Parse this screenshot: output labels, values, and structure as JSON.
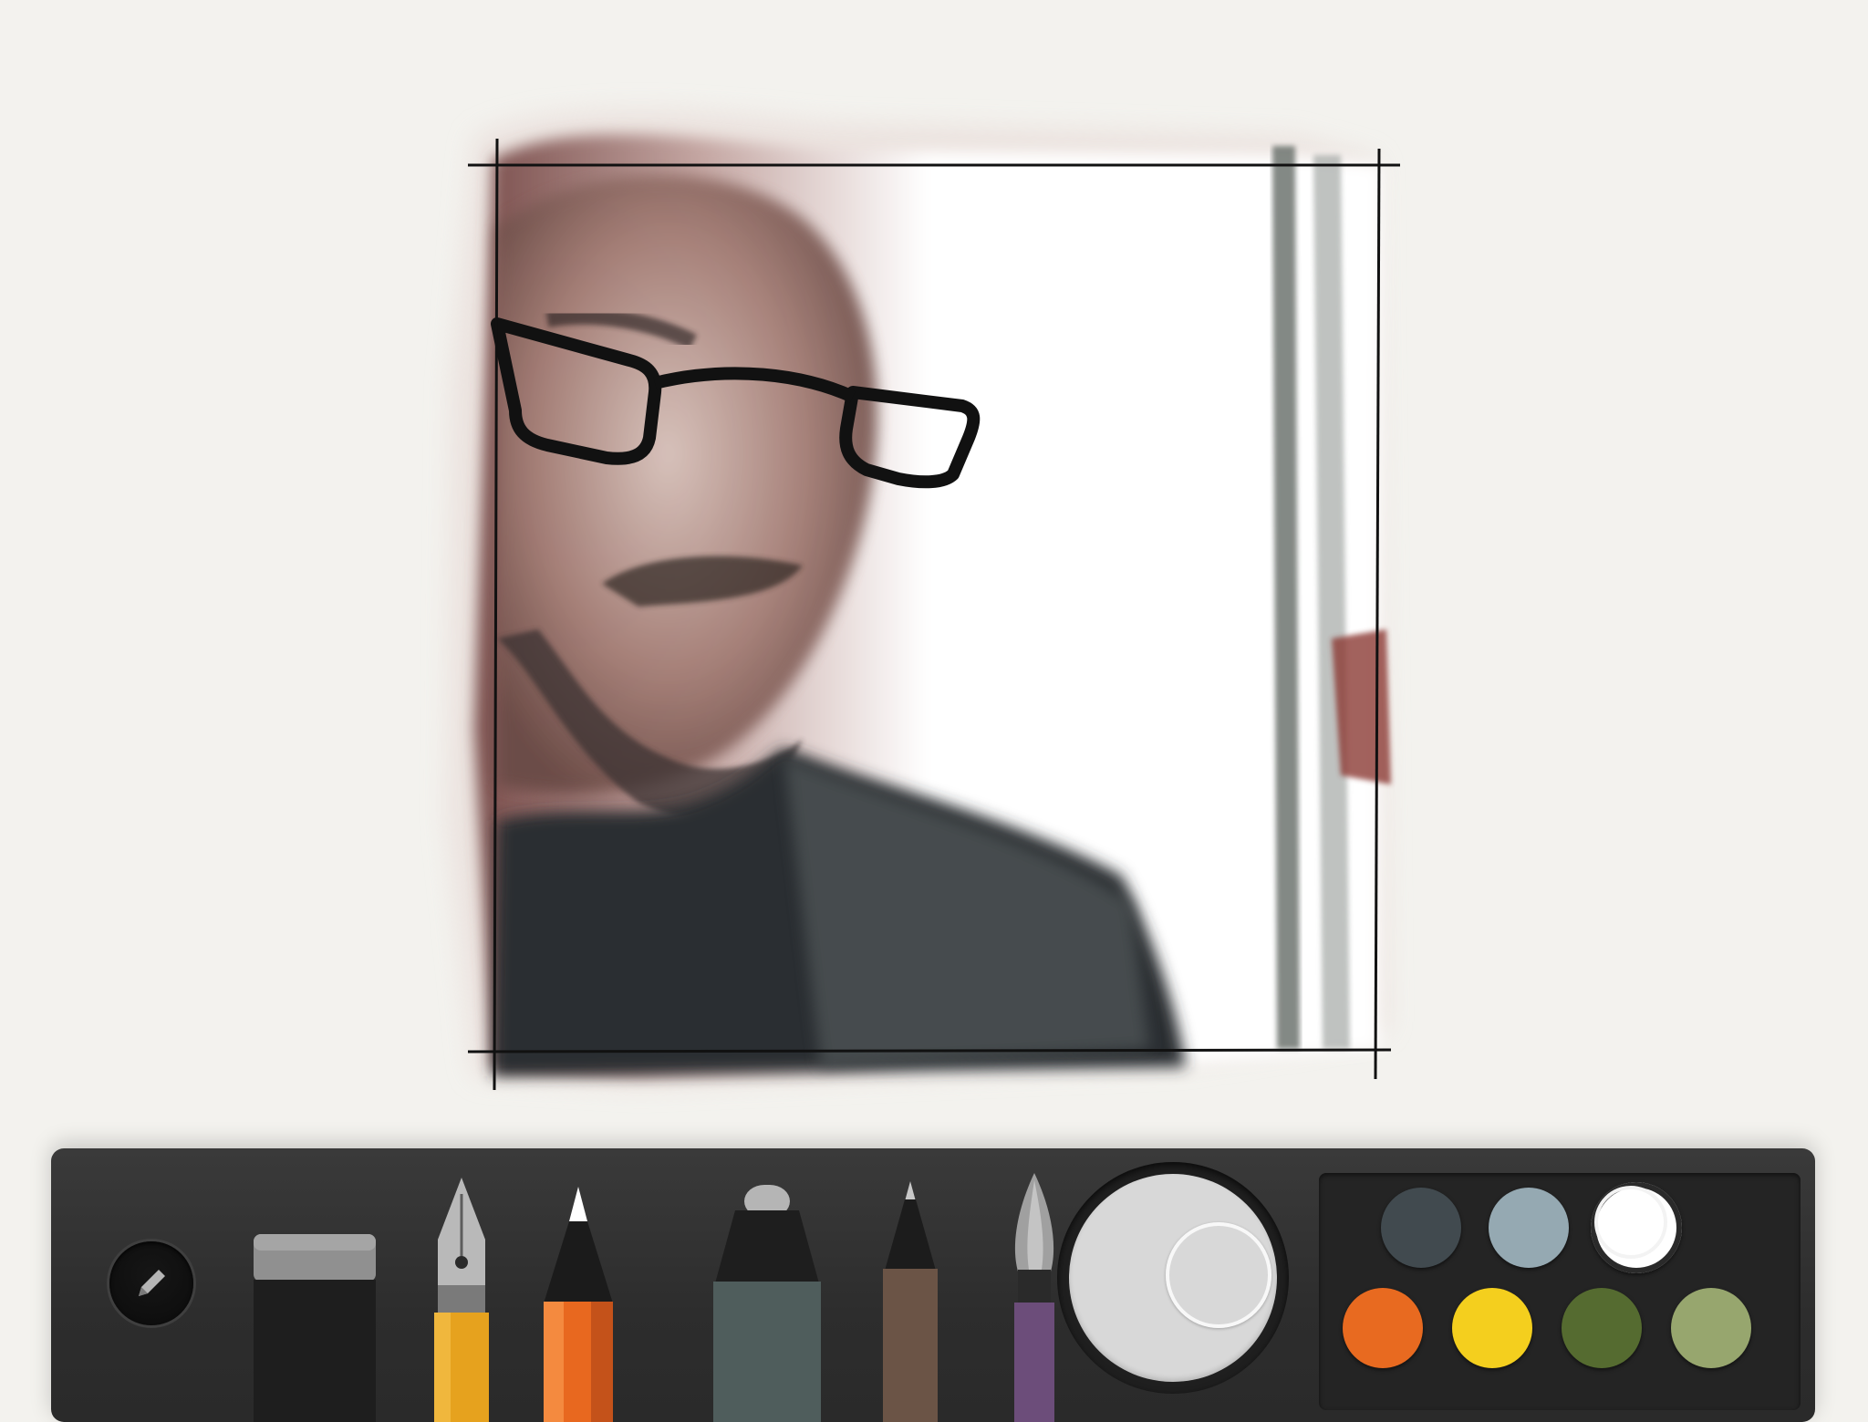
{
  "app": {
    "canvas_background": "#f3f2ee",
    "toolbar_color": "#2e2e2e"
  },
  "canvas": {
    "content": "watercolor-sketch-portrait"
  },
  "toolbar": {
    "mode_button": {
      "icon": "pencil-icon"
    },
    "tools": [
      {
        "name": "eraser",
        "icon": "eraser-icon"
      },
      {
        "name": "fountain-pen",
        "icon": "fountain-pen-icon",
        "color": "#e6a21e"
      },
      {
        "name": "pencil",
        "icon": "pencil-tool-icon",
        "color": "#e8681f",
        "selected": true
      },
      {
        "name": "marker",
        "icon": "marker-icon",
        "color": "#4f5d5c"
      },
      {
        "name": "pen",
        "icon": "pen-icon",
        "color": "#6b5446"
      },
      {
        "name": "paintbrush",
        "icon": "paintbrush-icon",
        "color": "#6c4d7a"
      }
    ],
    "size_dial": {
      "value": 0.5
    },
    "palette": {
      "swatches": [
        {
          "color": "#414a4f"
        },
        {
          "color": "#95a9b2"
        },
        {
          "color": "#ffffff",
          "selected": true
        },
        {
          "color": "#e86a20"
        },
        {
          "color": "#f4cf1e"
        },
        {
          "color": "#556b30"
        },
        {
          "color": "#97a66e"
        }
      ]
    }
  }
}
